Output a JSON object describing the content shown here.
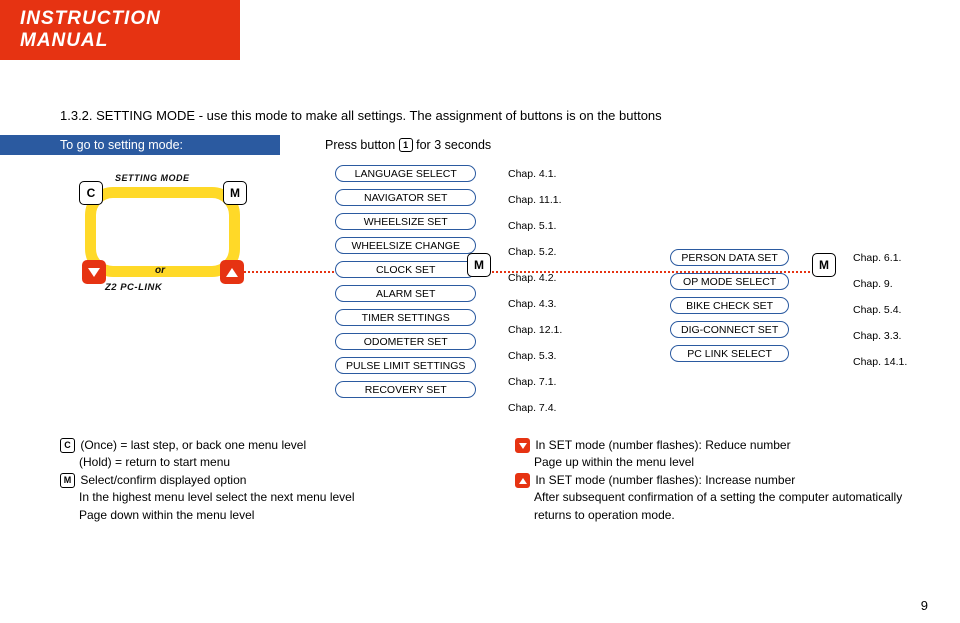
{
  "header": {
    "title": "INSTRUCTION MANUAL"
  },
  "intro": "1.3.2. SETTING MODE - use this mode to make all settings. The assignment of buttons is on the buttons",
  "blue_bar": "To go to setting mode:",
  "press": {
    "prefix": "Press button ",
    "btn": "1",
    "suffix": " for 3 seconds"
  },
  "device": {
    "top_label": "SETTING MODE",
    "bottom_label": "Z2 PC-LINK",
    "c": "C",
    "m": "M",
    "or": "or"
  },
  "menu_col1": [
    {
      "label": "LANGUAGE SELECT",
      "chap": "Chap. 4.1."
    },
    {
      "label": "NAVIGATOR SET",
      "chap": "Chap. 11.1."
    },
    {
      "label": "WHEELSIZE SET",
      "chap": "Chap. 5.1."
    },
    {
      "label": "WHEELSIZE CHANGE",
      "chap": "Chap. 5.2."
    },
    {
      "label": "CLOCK SET",
      "chap": "Chap. 4.2."
    },
    {
      "label": "ALARM SET",
      "chap": "Chap. 4.3."
    },
    {
      "label": "TIMER SETTINGS",
      "chap": "Chap. 12.1."
    },
    {
      "label": "ODOMETER SET",
      "chap": "Chap. 5.3."
    },
    {
      "label": "PULSE LIMIT SETTINGS",
      "chap": "Chap. 7.1."
    },
    {
      "label": "RECOVERY SET",
      "chap": "Chap. 7.4."
    }
  ],
  "menu_col3": [
    {
      "label": "PERSON DATA SET",
      "chap": "Chap. 6.1."
    },
    {
      "label": "OP MODE SELECT",
      "chap": "Chap. 9."
    },
    {
      "label": "BIKE CHECK SET",
      "chap": "Chap. 5.4."
    },
    {
      "label": "DIG-CONNECT SET",
      "chap": "Chap. 3.3."
    },
    {
      "label": "PC LINK SELECT",
      "chap": "Chap. 14.1."
    }
  ],
  "m_badge": "M",
  "notes": {
    "left": {
      "c_line": "(Once) = last step, or back one menu level",
      "hold": "(Hold) = return to start menu",
      "m_line": "Select/confirm displayed option",
      "sub1": "In the highest menu level select the next menu level",
      "sub2": "Page down within the menu level"
    },
    "right": {
      "down": "In SET mode (number flashes): Reduce number",
      "down_sub": "Page up within the menu level",
      "up": "In SET mode (number flashes): Increase number",
      "up_sub": "After subsequent confirmation of a setting the computer automatically returns to operation mode."
    }
  },
  "page": "9"
}
